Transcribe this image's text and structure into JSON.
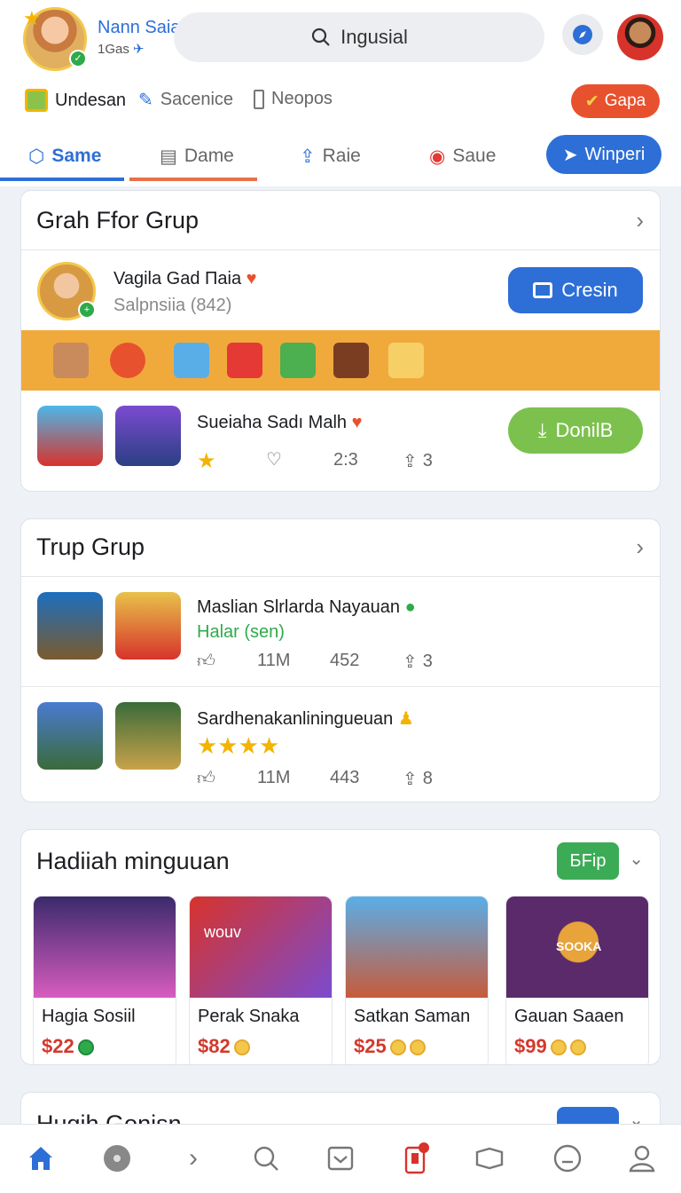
{
  "header": {
    "username": "Nann Saia Sosia",
    "user_sub": "1Gas",
    "search_label": "Ingusial"
  },
  "subnav": {
    "items": [
      "Undesan",
      "Sacenice",
      "Neopos"
    ],
    "pill": "Gapa"
  },
  "tabs": {
    "items": [
      "Same",
      "Dame",
      "Raie",
      "Saue"
    ],
    "cta": "Winperi",
    "active_color": "#2d6fd6"
  },
  "card1": {
    "title": "Grah Ffor Grup",
    "profile_name": "Vagila Gad Паia",
    "profile_sub": "Salpnsiia (842)",
    "profile_button": "Cresin",
    "row_title": "Sueiaha Sadı Malh",
    "row_stats": [
      "2:3",
      "3"
    ],
    "row_button": "DonilB"
  },
  "card2": {
    "title": "Trup Grup",
    "rows": [
      {
        "title": "Maslian Slrlarda Nayauan",
        "sub": "Halar (sen)",
        "stats": [
          "11M",
          "452",
          "3"
        ]
      },
      {
        "title": "Sardhenakanliningueuan",
        "stats": [
          "11M",
          "443",
          "8"
        ]
      }
    ]
  },
  "card3": {
    "title": "Hadiiah minguuan",
    "badge": "БFip",
    "products": [
      {
        "name": "Hagia Sosiil",
        "price": "$22"
      },
      {
        "name": "Perak Snaka",
        "price": "$82"
      },
      {
        "name": "Satkan Saman",
        "price": "$25"
      },
      {
        "name": "Gauan Saaen",
        "price": "$99"
      }
    ],
    "product_banner_1": "wouv",
    "product_banner_3": "SOOKA"
  },
  "card4": {
    "title": "Hugih Gonisn"
  }
}
